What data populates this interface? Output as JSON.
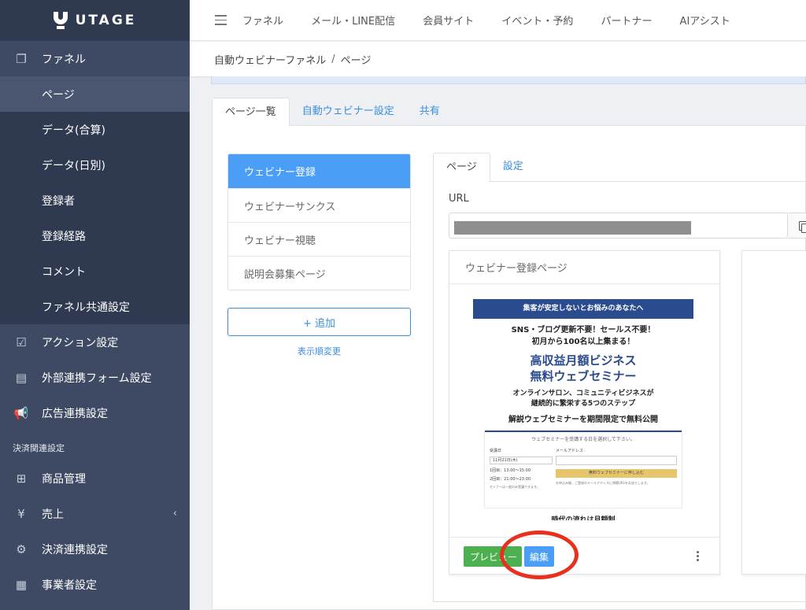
{
  "brand": {
    "name": "UTAGE"
  },
  "sidebar": {
    "items": [
      {
        "label": "ファネル",
        "icon": "copy-icon"
      },
      {
        "label": "ページ",
        "sub": true,
        "active": true
      },
      {
        "label": "データ(合算)",
        "sub": true
      },
      {
        "label": "データ(日別)",
        "sub": true
      },
      {
        "label": "登録者",
        "sub": true
      },
      {
        "label": "登録経路",
        "sub": true
      },
      {
        "label": "コメント",
        "sub": true
      },
      {
        "label": "ファネル共通設定",
        "sub": true
      },
      {
        "label": "アクション設定",
        "icon": "checkbox-icon"
      },
      {
        "label": "外部連携フォーム設定",
        "icon": "form-icon"
      },
      {
        "label": "広告連携設定",
        "icon": "megaphone-icon"
      }
    ],
    "section_label": "決済関連設定",
    "payment_items": [
      {
        "label": "商品管理",
        "icon": "basket-icon"
      },
      {
        "label": "売上",
        "icon": "yen-icon"
      },
      {
        "label": "決済連携設定",
        "icon": "gear-icon"
      },
      {
        "label": "事業者設定",
        "icon": "building-icon"
      }
    ]
  },
  "topnav": [
    "ファネル",
    "メール・LINE配信",
    "会員サイト",
    "イベント・予約",
    "パートナー",
    "AIアシスト"
  ],
  "breadcrumb": {
    "first": "自動ウェビナーファネル",
    "separator": "/",
    "current": "ページ"
  },
  "main_tabs": [
    "ページ一覧",
    "自動ウェビナー設定",
    "共有"
  ],
  "page_list": [
    "ウェビナー登録",
    "ウェビナーサンクス",
    "ウェビナー視聴",
    "説明会募集ページ"
  ],
  "add_button": "+ 追加",
  "reorder_link": "表示順変更",
  "detail_tabs": [
    "ページ",
    "設定"
  ],
  "url_label": "URL",
  "card": {
    "title": "ウェビナー登録ページ",
    "preview_label": "プレビュー",
    "edit_label": "編集"
  },
  "thumbnail": {
    "banner": "集客が安定しないとお悩みのあなたへ",
    "line1": "SNS・ブログ更新不要！セールス不要！",
    "line2": "初月から100名以上集まる！",
    "big1": "高収益月額ビジネス",
    "big2": "無料ウェブセミナー",
    "mid1": "オンラインサロン、コミュニティビジネスが",
    "mid2": "継続的に繁栄する5つのステップ",
    "mid3": "解説ウェブセミナーを期間限定で無料公開",
    "form_header": "ウェブセミナーを受講する日を選択して下さい。",
    "date_label": "受講日",
    "date_value": "11月21日(木)",
    "slot1": "1回目：13:00〜15:00",
    "slot2": "2回目：21:00〜23:00",
    "note_left": "セミナーは一度のみ受講できます。",
    "email_label": "メールアドレス",
    "submit": "無料ウェブセミナーに申し込む",
    "note_right": "お申込み後、ご登録のメールアドレスに視聴URLをお送りします。",
    "bottom": "時代の流れは月額制"
  },
  "colors": {
    "sidebar": "#3e4a63",
    "accent": "#4b9ef5",
    "preview": "#4caf50",
    "annotation": "#e8301f"
  }
}
